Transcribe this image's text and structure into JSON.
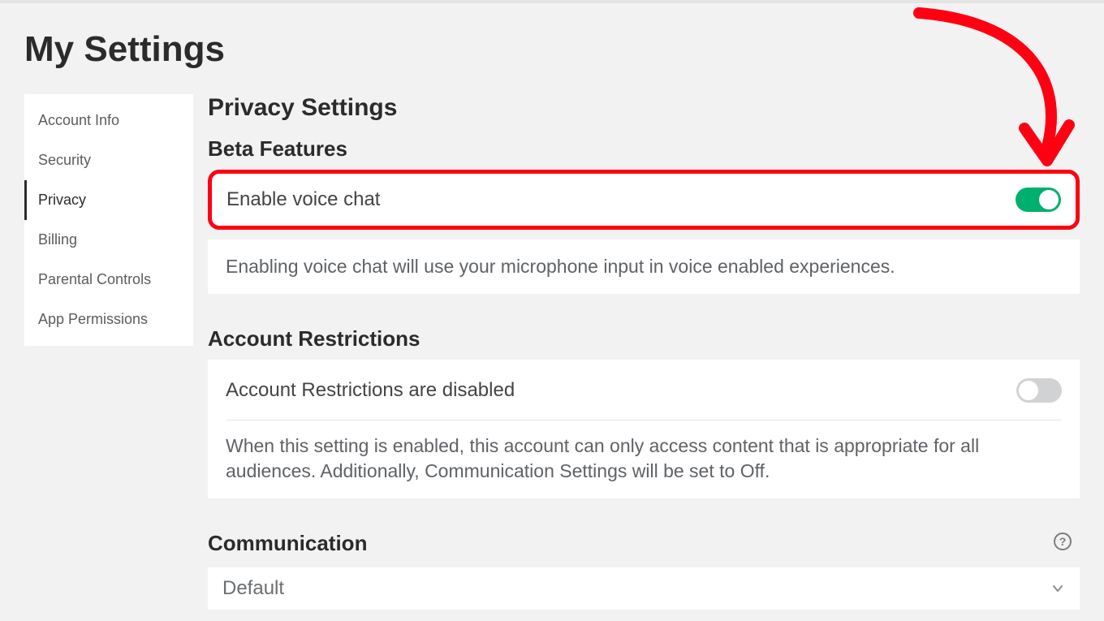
{
  "page": {
    "title": "My Settings"
  },
  "sidebar": {
    "items": [
      {
        "label": "Account Info",
        "active": false
      },
      {
        "label": "Security",
        "active": false
      },
      {
        "label": "Privacy",
        "active": true
      },
      {
        "label": "Billing",
        "active": false
      },
      {
        "label": "Parental Controls",
        "active": false
      },
      {
        "label": "App Permissions",
        "active": false
      }
    ]
  },
  "privacy": {
    "heading": "Privacy Settings",
    "beta": {
      "heading": "Beta Features",
      "voice_chat_label": "Enable voice chat",
      "voice_chat_enabled": true,
      "voice_chat_help": "Enabling voice chat will use your microphone input in voice enabled experiences."
    },
    "restrictions": {
      "heading": "Account Restrictions",
      "status_label": "Account Restrictions are disabled",
      "enabled": false,
      "help": "When this setting is enabled, this account can only access content that is appropriate for all audiences. Additionally, Communication Settings will be set to Off."
    },
    "communication": {
      "heading": "Communication",
      "selected": "Default"
    }
  },
  "colors": {
    "highlight": "#ff0012",
    "toggle_on": "#00b06f"
  }
}
